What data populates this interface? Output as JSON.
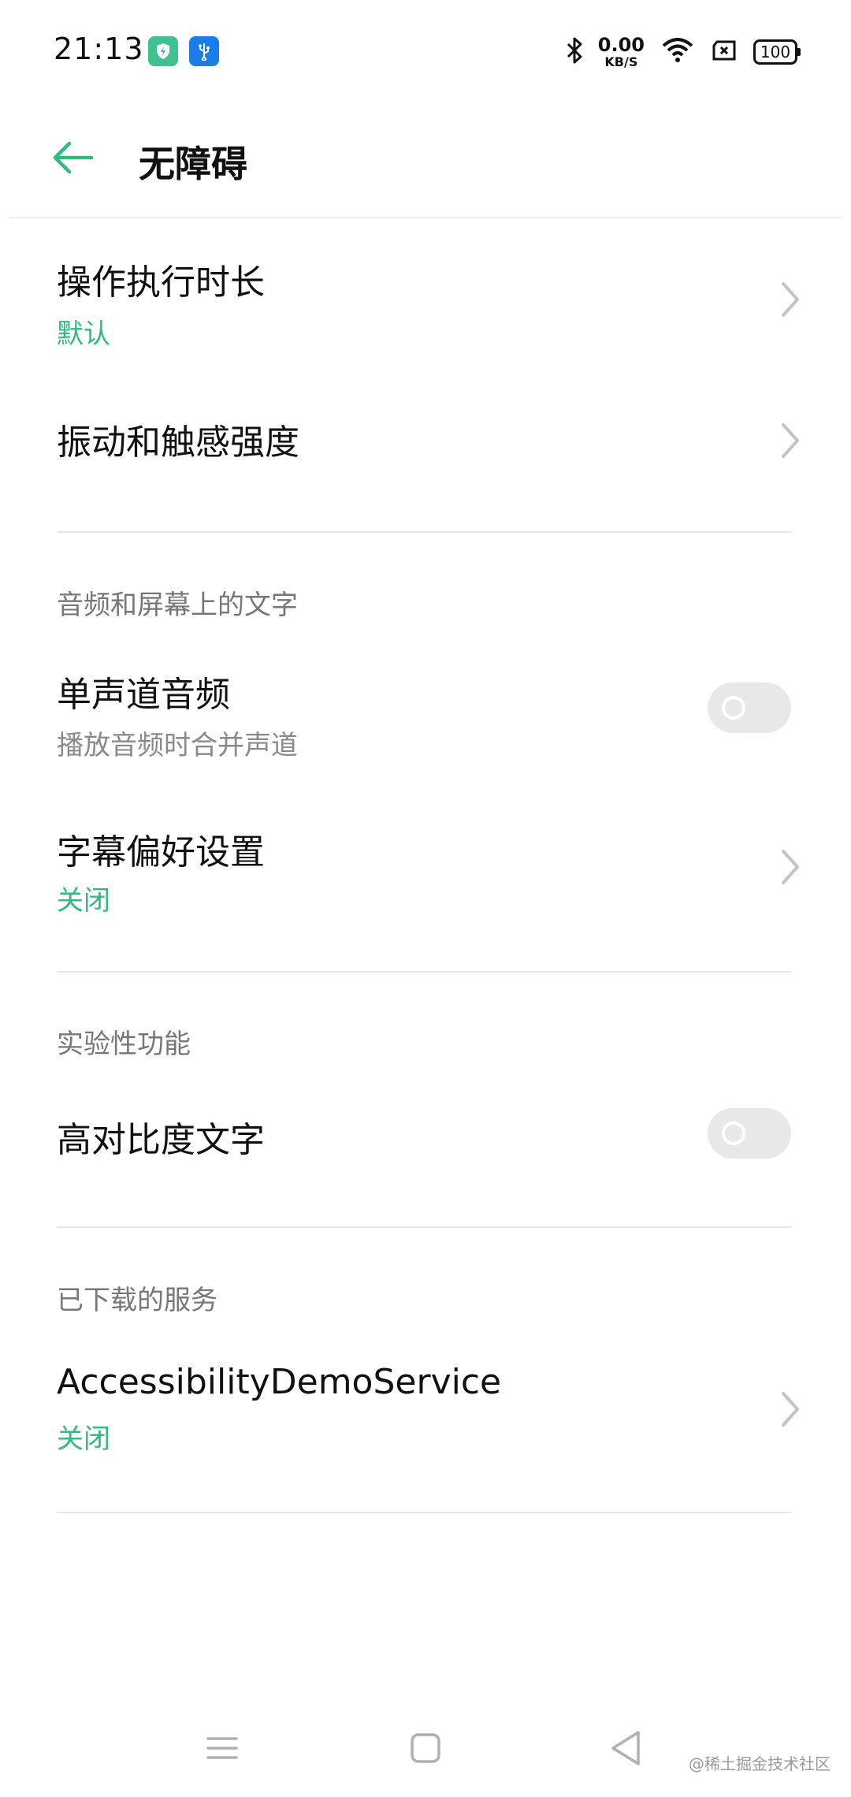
{
  "status_bar": {
    "time": "21:13",
    "net_speed_value": "0.00",
    "net_speed_unit": "KB/S",
    "battery": "100",
    "icons": [
      "shield-app-icon",
      "usb-icon",
      "bluetooth-icon",
      "wifi-icon",
      "sim-off-icon",
      "battery-icon"
    ]
  },
  "header": {
    "title": "无障碍",
    "back_icon": "arrow-left-icon"
  },
  "items": {
    "operation_duration": {
      "title": "操作执行时长",
      "value": "默认"
    },
    "vibration": {
      "title": "振动和触感强度"
    },
    "mono_audio": {
      "title": "单声道音频",
      "subtitle": "播放音频时合并声道",
      "on": false
    },
    "captions": {
      "title": "字幕偏好设置",
      "value": "关闭"
    },
    "high_contrast": {
      "title": "高对比度文字",
      "on": false
    },
    "demo_service": {
      "title": "AccessibilityDemoService",
      "value": "关闭"
    }
  },
  "sections": {
    "audio_text": "音频和屏幕上的文字",
    "experimental": "实验性功能",
    "downloaded": "已下载的服务"
  },
  "colors": {
    "accent": "#30bb7f",
    "toggle_off": "#e8e8e8"
  },
  "watermark": "@稀土掘金技术社区"
}
